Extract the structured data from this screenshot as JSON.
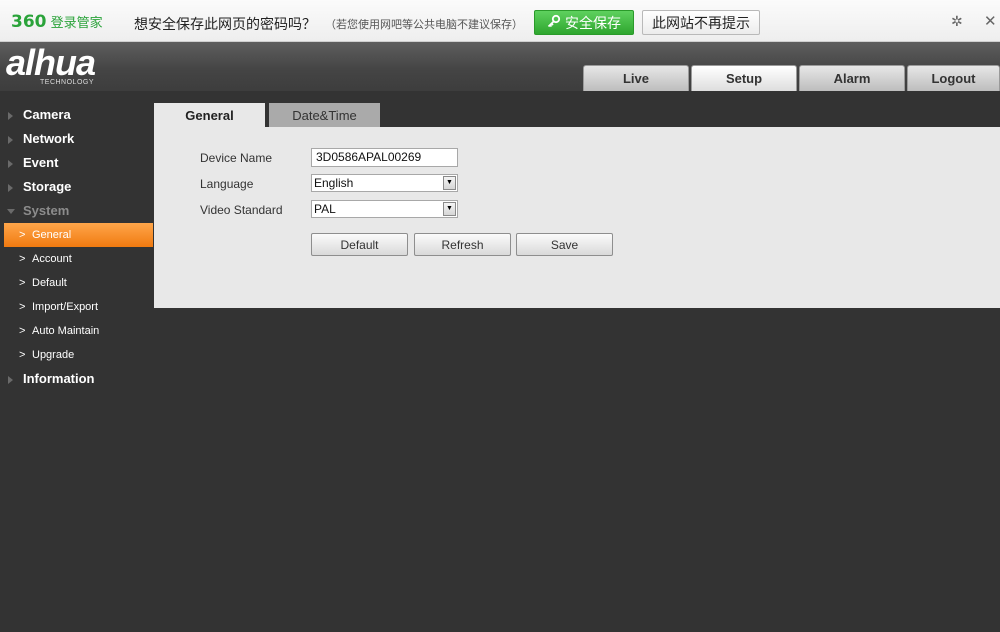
{
  "password_bar": {
    "brand_number": "360",
    "brand_text": "登录管家",
    "question": "想安全保存此网页的密码吗？",
    "hint": "（若您使用网吧等公共电脑不建议保存）",
    "save_label": "安全保存",
    "never_label": "此网站不再提示",
    "settings_icon": "gear-icon",
    "close_icon": "close-icon",
    "accent_color": "#2fa62f"
  },
  "header": {
    "logo_text": "alhua",
    "logo_subtitle": "TECHNOLOGY",
    "tabs": [
      {
        "label": "Live",
        "active": false
      },
      {
        "label": "Setup",
        "active": true
      },
      {
        "label": "Alarm",
        "active": false
      },
      {
        "label": "Logout",
        "active": false
      }
    ]
  },
  "sidebar": {
    "categories": [
      {
        "label": "Camera"
      },
      {
        "label": "Network"
      },
      {
        "label": "Event"
      },
      {
        "label": "Storage"
      },
      {
        "label": "System",
        "expanded": true
      },
      {
        "label": "Information"
      }
    ],
    "system_items": [
      {
        "label": "General",
        "active": true
      },
      {
        "label": "Account"
      },
      {
        "label": "Default"
      },
      {
        "label": "Import/Export"
      },
      {
        "label": "Auto Maintain"
      },
      {
        "label": "Upgrade"
      }
    ],
    "active_color": "#f58a1f"
  },
  "content": {
    "tabs": [
      {
        "label": "General",
        "active": true
      },
      {
        "label": "Date&Time",
        "active": false
      }
    ],
    "form": {
      "device_name_label": "Device Name",
      "device_name_value": "3D0586APAL00269",
      "language_label": "Language",
      "language_value": "English",
      "video_standard_label": "Video Standard",
      "video_standard_value": "PAL"
    },
    "buttons": {
      "default_label": "Default",
      "refresh_label": "Refresh",
      "save_label": "Save"
    }
  }
}
